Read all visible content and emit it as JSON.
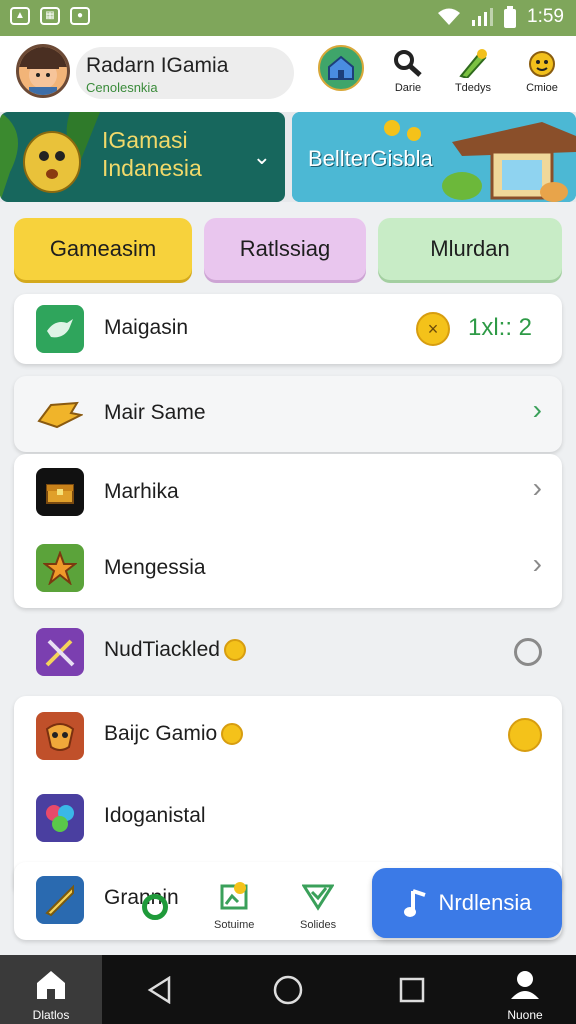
{
  "status_bar": {
    "time": "1:59"
  },
  "header": {
    "profile_name": "Radarn IGamia",
    "profile_sub": "Cenolesnkia",
    "buttons": [
      {
        "label": "Darie",
        "icon": "magnifier-icon"
      },
      {
        "label": "Tdedys",
        "icon": "leaf-pencil-icon"
      },
      {
        "label": "Cmioe",
        "icon": "mascot-icon"
      }
    ]
  },
  "banners": [
    {
      "title_line1": "IGamasi",
      "title_line2": "Indanesia"
    },
    {
      "title": "BellterGisbla"
    }
  ],
  "tabs": [
    {
      "label": "Gameasim",
      "color": "#f7d23c"
    },
    {
      "label": "Ratlssiag",
      "color": "#e9c6ee"
    },
    {
      "label": "Mlurdan",
      "color": "#c8ecc6"
    }
  ],
  "list": [
    {
      "label": "Maigasin",
      "value": "1xl:: 2",
      "icon": "dragon-icon"
    },
    {
      "label": "Mair Same",
      "icon": "gold-bird-icon"
    },
    {
      "label": "Marhika",
      "icon": "treasure-chest-icon"
    },
    {
      "label": "Mengessia",
      "icon": "star-sword-icon"
    },
    {
      "label": "NudTiackled",
      "icon": "crossed-swords-icon"
    },
    {
      "label": "Baijc Gamio",
      "icon": "warrior-mask-icon"
    },
    {
      "label": "Idoganistal",
      "icon": "colorful-knot-icon"
    },
    {
      "label": "Grannin",
      "icon": "blade-icon"
    }
  ],
  "bottom_mini": [
    {
      "label": "Sotuime",
      "icon": "badge-icon"
    },
    {
      "label": "Solides",
      "icon": "shield-check-icon"
    }
  ],
  "cta": {
    "label": "Nrdlensia",
    "icon": "music-note-icon"
  },
  "navbar": {
    "home_label": "Dlatlos",
    "last_label": "Nuone"
  },
  "colors": {
    "accent": "#3b7ae7",
    "status_bar": "#7fa65b",
    "value_green": "#2e9a46"
  }
}
